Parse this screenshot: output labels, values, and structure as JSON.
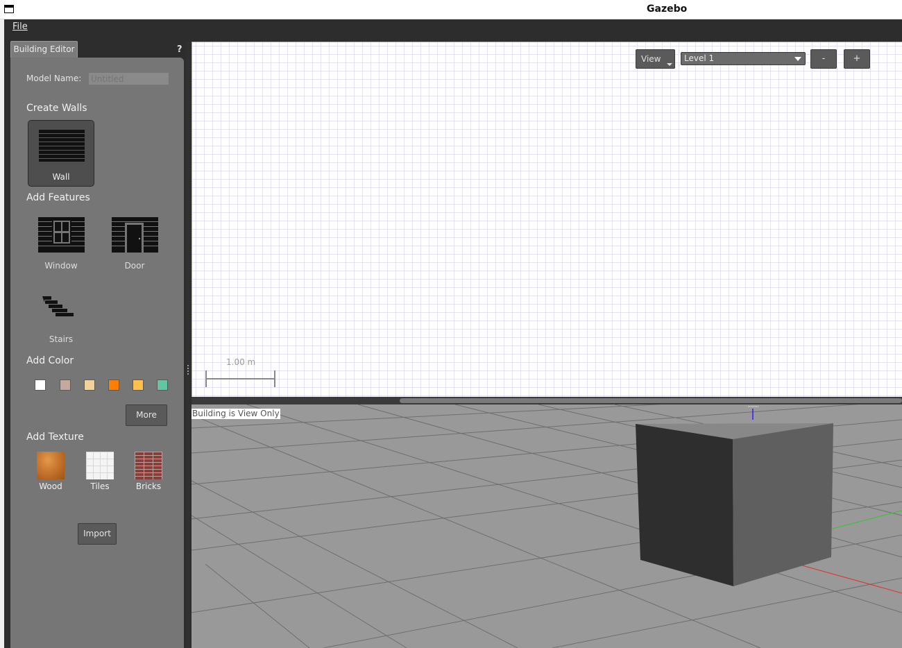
{
  "window": {
    "title": "Gazebo"
  },
  "menu": {
    "file_label": "File"
  },
  "panel": {
    "tab_label": "Building Editor",
    "help_label": "?",
    "model_name_label": "Model Name:",
    "model_name_placeholder": "Untitled",
    "create_walls_heading": "Create Walls",
    "wall_label": "Wall",
    "add_features_heading": "Add Features",
    "window_label": "Window",
    "door_label": "Door",
    "stairs_label": "Stairs",
    "add_color_heading": "Add Color",
    "colors": [
      "#ffffff",
      "#c4a9a0",
      "#f0d29a",
      "#ff7f00",
      "#ffc04d",
      "#62c6a0"
    ],
    "more_label": "More",
    "add_texture_heading": "Add Texture",
    "textures": {
      "wood": "Wood",
      "tiles": "Tiles",
      "bricks": "Bricks"
    },
    "import_label": "Import"
  },
  "editor2d": {
    "view_label": "View",
    "level_value": "Level 1",
    "zoom_out_label": "-",
    "zoom_in_label": "+",
    "scale_label": "1.00 m"
  },
  "view3d": {
    "status": "Building is View Only"
  }
}
